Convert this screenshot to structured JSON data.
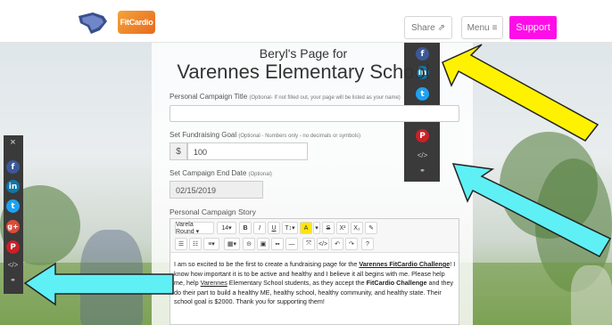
{
  "header": {
    "logo_text": "FitCardio",
    "share_label": "Share",
    "menu_label": "Menu",
    "support_label": "Support"
  },
  "share_menu": {
    "icons": [
      "facebook-icon",
      "linkedin-icon",
      "twitter-icon",
      "google-plus-icon",
      "pinterest-icon",
      "embed-icon",
      "link-icon"
    ]
  },
  "left_bar": {
    "close": "×",
    "icons": [
      "facebook-icon",
      "linkedin-icon",
      "twitter-icon",
      "google-plus-icon",
      "pinterest-icon",
      "embed-icon",
      "link-icon"
    ]
  },
  "page": {
    "title": "Beryl's Page for",
    "school": "Varennes Elementary School"
  },
  "form": {
    "campaign_title_label": "Personal Campaign Title",
    "campaign_title_hint": "(Optional- If not filled out, your page will be listed as your name)",
    "campaign_title_value": "",
    "goal_label": "Set Fundraising Goal",
    "goal_hint": "(Optional - Numbers only - no decimals or symbols)",
    "goal_currency": "$",
    "goal_value": "100",
    "end_date_label": "Set Campaign End Date",
    "end_date_hint": "(Optional)",
    "end_date_value": "02/15/2019",
    "story_label": "Personal Campaign Story"
  },
  "editor": {
    "font_name": "Varela Round ▾",
    "font_size": "14▾",
    "row1": [
      "B",
      "I",
      "U",
      "T↕▾",
      "A",
      "▾",
      "S",
      "X²",
      "X₂",
      "✎"
    ],
    "row2": [
      "☰",
      "☷",
      "≡▾",
      "▦▾",
      "⊝",
      "▣",
      "▪▪",
      "—",
      "⤧",
      "</>",
      "↶",
      "↷",
      "?"
    ],
    "story": {
      "p1": "I am so excited to be the first to create a fundraising page for the ",
      "b1": "Varennes FitCardio Challenge",
      "p2": "! I know how important it is to be active and healthy and I believe it all begins with ",
      "p3": "me. Please help me, help ",
      "u1": "Varennes",
      "p4": " Elementary School students, as they accept the ",
      "b2": "FitCardio Challenge",
      "p5": " and they do their part to build a healthy ME, healthy school, healthy community, and healthy state.  Their school goal is $2000. Thank you for supporting them!"
    }
  },
  "annotations": {
    "yellow_arrow_color": "#fff200",
    "cyan_arrow_color": "#5ef0f5"
  }
}
